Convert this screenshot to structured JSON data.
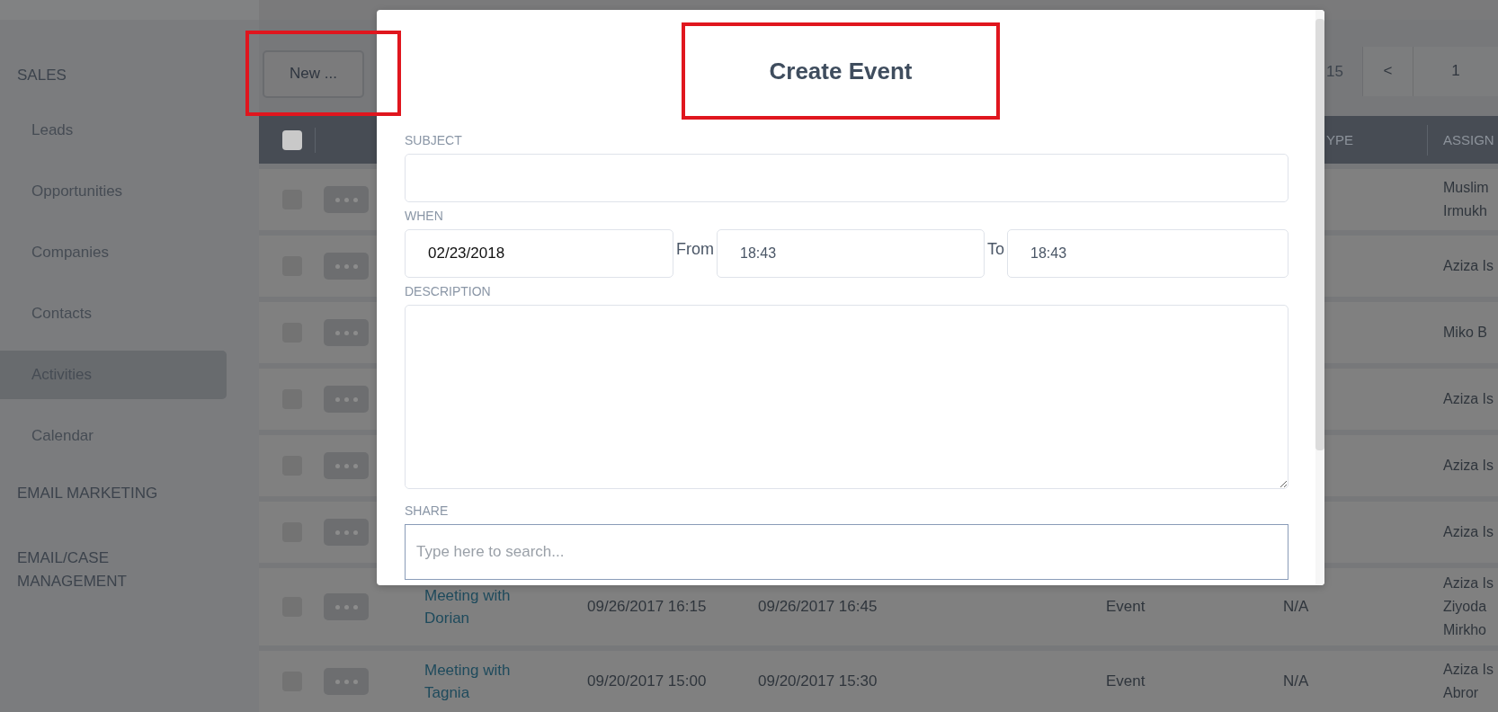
{
  "sidebar": {
    "sections": [
      {
        "title": "SALES",
        "items": [
          {
            "label": "Leads",
            "selected": false
          },
          {
            "label": "Opportunities",
            "selected": false
          },
          {
            "label": "Companies",
            "selected": false
          },
          {
            "label": "Contacts",
            "selected": false
          },
          {
            "label": "Activities",
            "selected": true
          },
          {
            "label": "Calendar",
            "selected": false
          }
        ]
      },
      {
        "title": "EMAIL MARKETING"
      },
      {
        "title": "EMAIL/CASE MANAGEMENT"
      }
    ]
  },
  "toolbar": {
    "new_button": {
      "label": "New ...",
      "highlighted": true
    },
    "pagination": {
      "count": "15",
      "prev": "<",
      "page": "1"
    }
  },
  "table": {
    "header_checked": false,
    "columns": [
      "YPE",
      "ASSIGN"
    ],
    "rows": [
      {
        "checked": false,
        "assigned": [
          "Muslim",
          "Irmukh"
        ]
      },
      {
        "checked": false,
        "assigned": [
          "Aziza Is"
        ]
      },
      {
        "checked": false,
        "assigned": [
          "Miko B"
        ]
      },
      {
        "checked": false,
        "assigned": [
          "Aziza Is"
        ]
      },
      {
        "checked": false,
        "assigned": [
          "Aziza Is"
        ]
      },
      {
        "checked": false,
        "assigned": [
          "Aziza Is"
        ]
      },
      {
        "checked": false,
        "subject": "Meeting with Dorian",
        "start": "09/26/2017 16:15",
        "end": "09/26/2017 16:45",
        "type": "Event",
        "status": "N/A",
        "assigned": [
          "Aziza Is",
          "Ziyoda",
          "Mirkho"
        ]
      },
      {
        "checked": false,
        "subject": "Meeting with Tagnia",
        "start": "09/20/2017 15:00",
        "end": "09/20/2017 15:30",
        "type": "Event",
        "status": "N/A",
        "assigned": [
          "Aziza Is",
          "Abror"
        ]
      }
    ]
  },
  "modal": {
    "title": "Create Event",
    "title_highlighted": true,
    "subject": {
      "label": "SUBJECT"
    },
    "when": {
      "label": "WHEN",
      "date": "02/23/2018",
      "from_label": "From",
      "from": "18:43",
      "to_label": "To",
      "to": "18:43"
    },
    "description": {
      "label": "DESCRIPTION"
    },
    "share": {
      "label": "SHARE",
      "placeholder": "Type here to search..."
    }
  }
}
